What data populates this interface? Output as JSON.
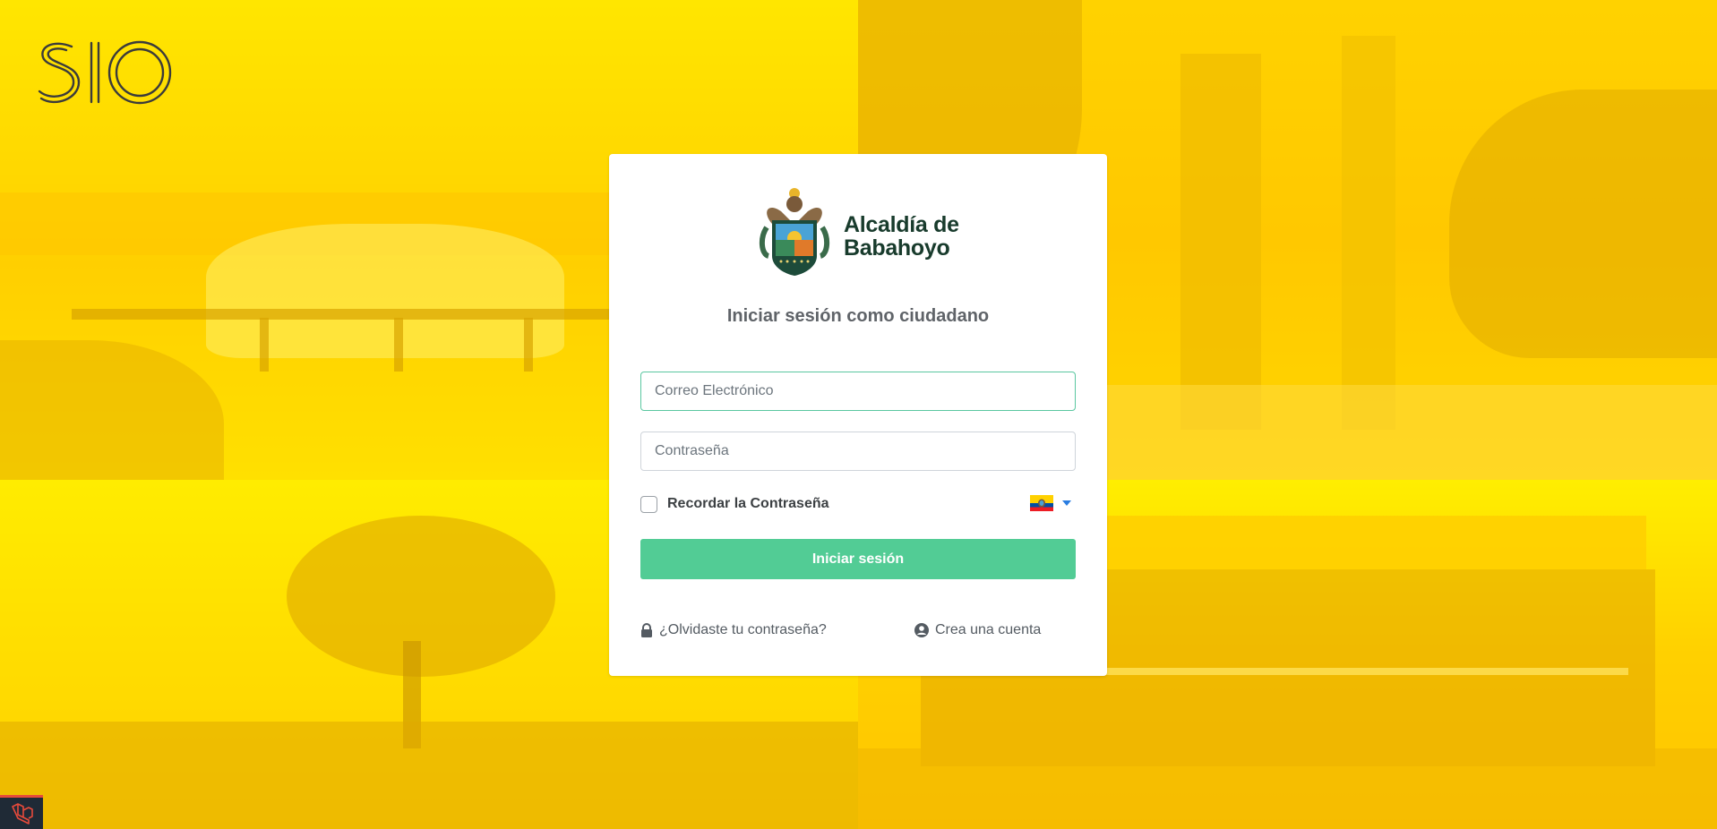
{
  "app_logo": {
    "text": "SIO"
  },
  "brand": {
    "line1": "Alcaldía de",
    "line2": "Babahoyo"
  },
  "login": {
    "title": "Iniciar sesión como ciudadano",
    "email_placeholder": "Correo Electrónico",
    "password_placeholder": "Contraseña",
    "remember_label": "Recordar la Contraseña",
    "remember_checked": false,
    "language": "ecuador-flag-icon",
    "submit_label": "Iniciar sesión",
    "forgot_label": "¿Olvidaste tu contraseña?",
    "create_label": "Crea una cuenta"
  },
  "colors": {
    "background": "#ffe800",
    "primary": "#52cc95",
    "brand_text": "#183b2c",
    "focus_border": "#5ac7a0"
  },
  "badge": {
    "icon": "laravel-icon"
  }
}
